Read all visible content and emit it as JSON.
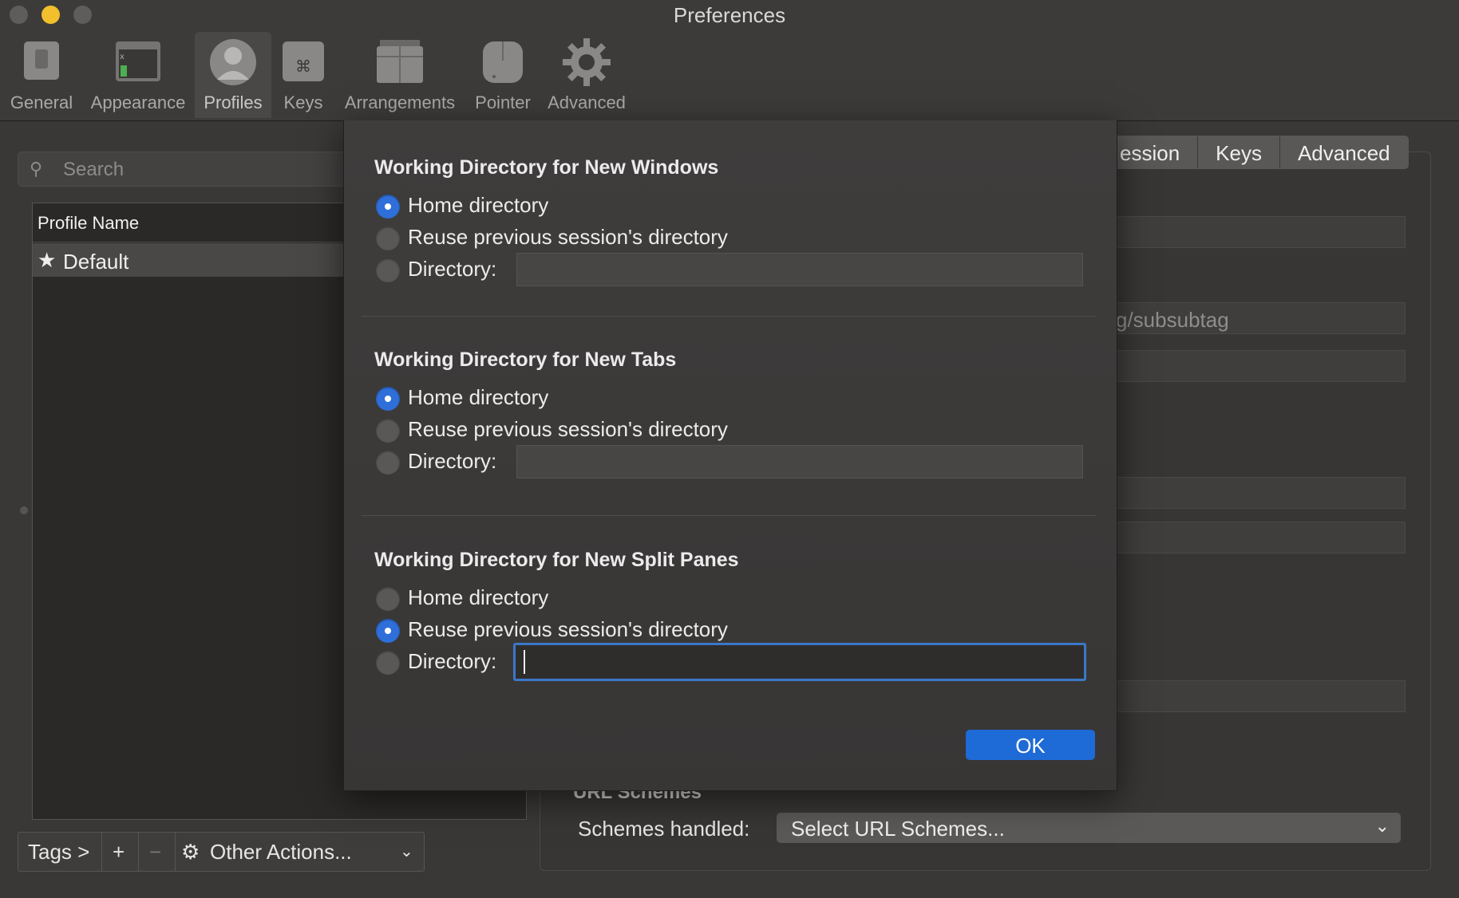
{
  "window": {
    "title": "Preferences"
  },
  "toolbar": {
    "items": [
      {
        "label": "General",
        "icon": "general-icon"
      },
      {
        "label": "Appearance",
        "icon": "appearance-icon"
      },
      {
        "label": "Profiles",
        "icon": "profiles-icon",
        "selected": true
      },
      {
        "label": "Keys",
        "icon": "keys-icon"
      },
      {
        "label": "Arrangements",
        "icon": "arrangements-icon"
      },
      {
        "label": "Pointer",
        "icon": "pointer-icon"
      },
      {
        "label": "Advanced",
        "icon": "advanced-gear-icon"
      }
    ]
  },
  "profiles": {
    "search_placeholder": "Search",
    "column_header": "Profile Name",
    "rows": [
      {
        "name": "Default",
        "icon": "star-icon"
      }
    ]
  },
  "bottom_bar": {
    "tags": "Tags >",
    "add": "+",
    "remove": "−",
    "other_actions": "Other Actions..."
  },
  "detail_tabs": [
    "ession",
    "Keys",
    "Advanced"
  ],
  "detail_background": {
    "ghost_text": "g/subsubtag",
    "schemes_label": "Schemes handled:",
    "schemes_value": "Select URL Schemes...",
    "url_schemes_title": "URL Schemes"
  },
  "sheet": {
    "sections": [
      {
        "title": "Working Directory for New Windows",
        "options": [
          "Home directory",
          "Reuse previous session's directory",
          "Directory:"
        ],
        "selected": 0,
        "directory_value": ""
      },
      {
        "title": "Working Directory for New Tabs",
        "options": [
          "Home directory",
          "Reuse previous session's directory",
          "Directory:"
        ],
        "selected": 0,
        "directory_value": ""
      },
      {
        "title": "Working Directory for New Split Panes",
        "options": [
          "Home directory",
          "Reuse previous session's directory",
          "Directory:"
        ],
        "selected": 1,
        "directory_value": ""
      }
    ],
    "ok_label": "OK"
  },
  "colors": {
    "accent": "#1e6ad6",
    "radio_selected": "#2f6fd9",
    "focus_ring": "#3a78c9",
    "minimize": "#f1c02c"
  }
}
